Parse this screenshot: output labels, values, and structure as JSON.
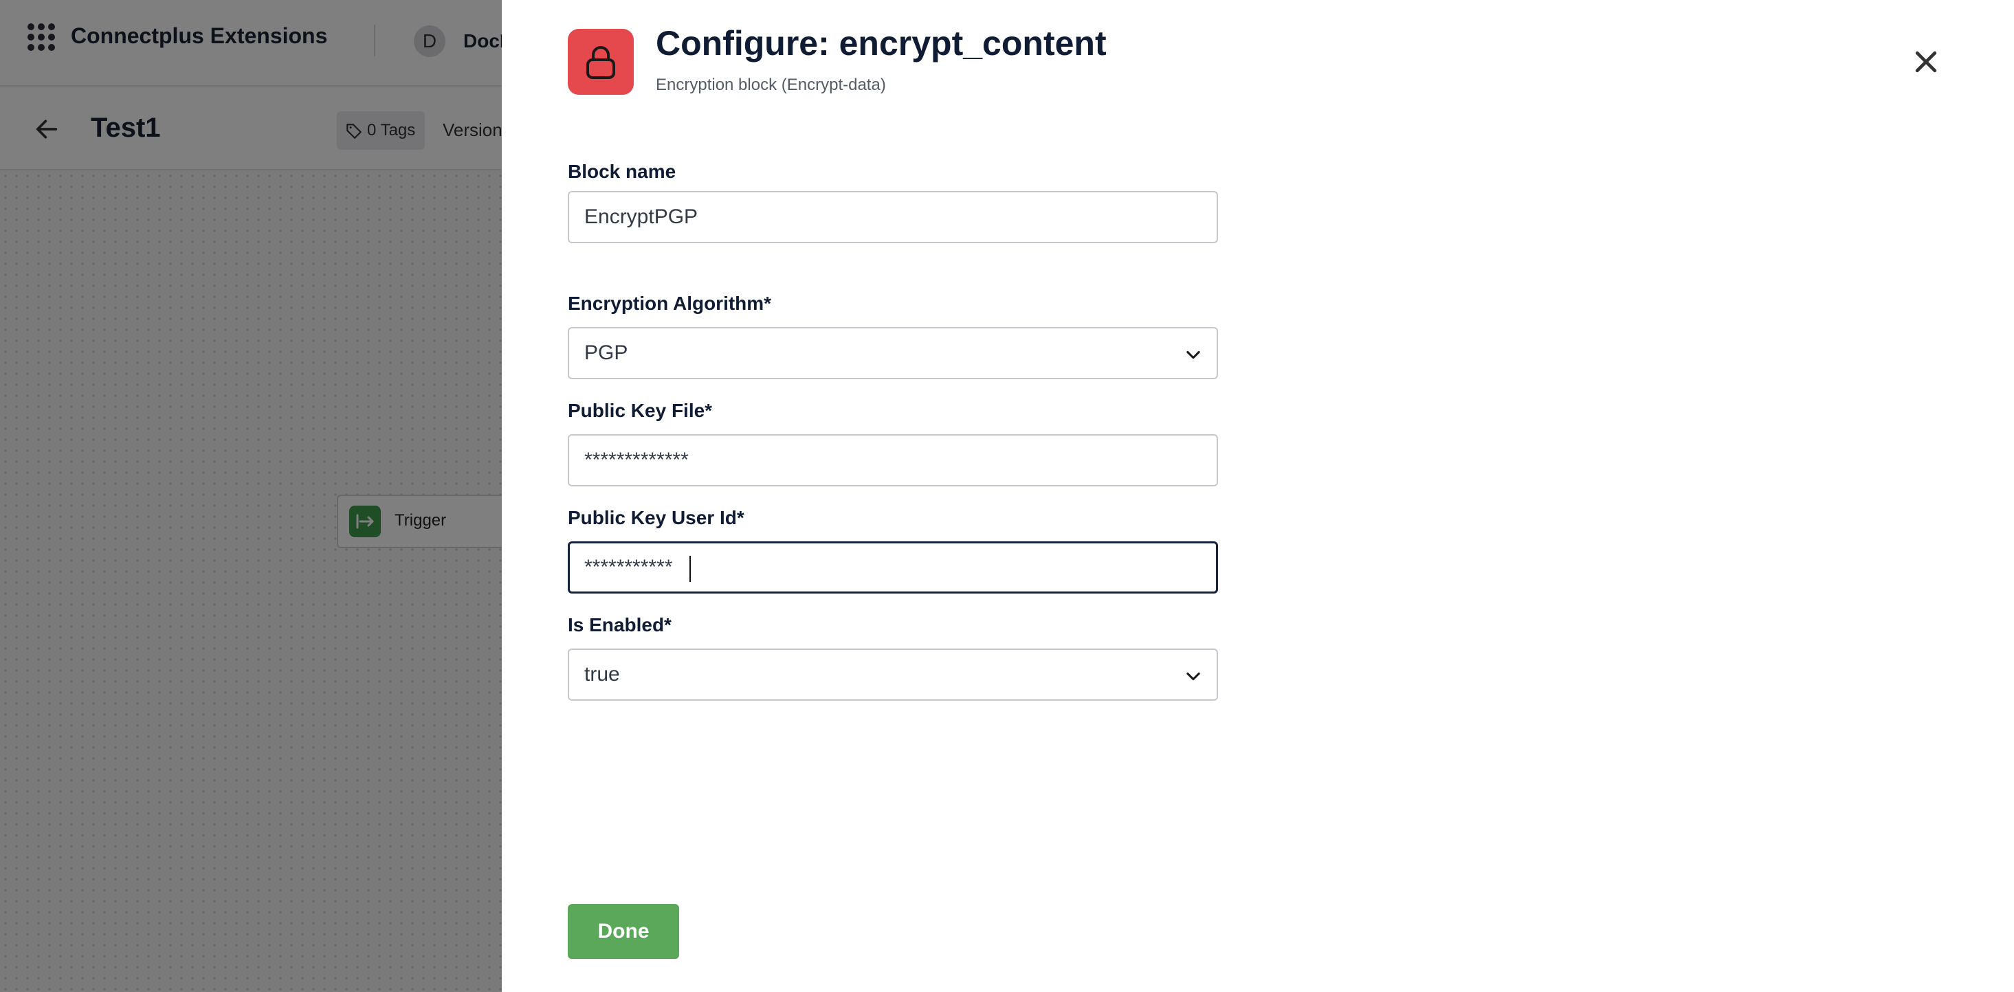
{
  "app": {
    "title": "Connectplus Extensions",
    "avatar_letter": "D",
    "org_name": "DocD"
  },
  "flow": {
    "name": "Test1",
    "tags_label": "0 Tags",
    "version_label": "Version"
  },
  "canvas": {
    "trigger_label": "Trigger"
  },
  "drawer": {
    "title": "Configure: encrypt_content",
    "subtitle": "Encryption block (Encrypt-data)",
    "fields": {
      "block_name": {
        "label": "Block name",
        "value": "EncryptPGP"
      },
      "algorithm": {
        "label": "Encryption Algorithm*",
        "value": "PGP"
      },
      "public_key_file": {
        "label": "Public Key File*",
        "value": "*************"
      },
      "public_key_user_id": {
        "label": "Public Key User Id*",
        "value": "***********"
      },
      "is_enabled": {
        "label": "Is Enabled*",
        "value": "true"
      }
    },
    "done_label": "Done"
  },
  "colors": {
    "accent_red": "#e5484d",
    "done_green": "#5ba85b",
    "trigger_green": "#3f9b4a",
    "heading_navy": "#0f1c33"
  },
  "icons": [
    "apps-grid-icon",
    "back-arrow-icon",
    "tag-icon",
    "trigger-icon",
    "lock-icon",
    "close-icon",
    "chevron-down-icon"
  ]
}
